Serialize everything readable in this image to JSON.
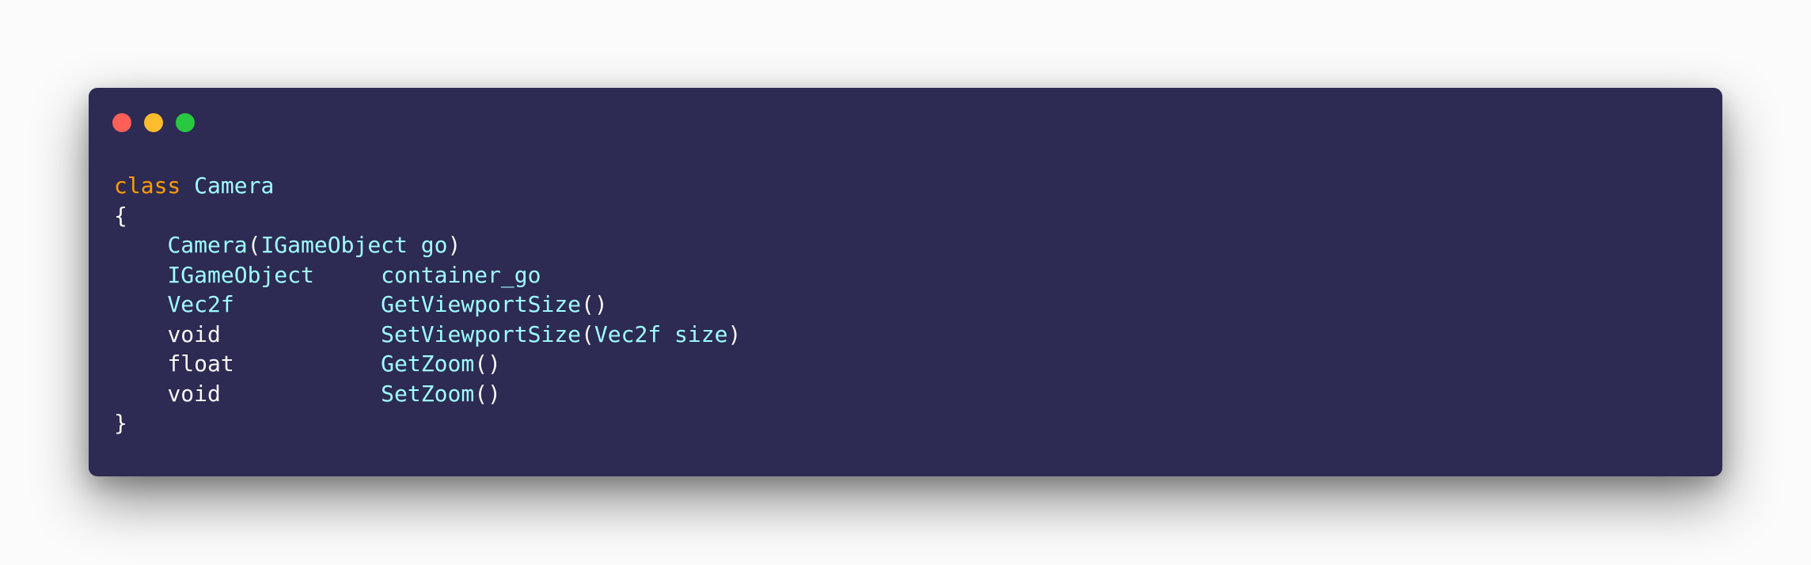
{
  "window": {
    "traffic_lights": [
      {
        "name": "close",
        "color": "#ff5f57"
      },
      {
        "name": "minimize",
        "color": "#febc2e"
      },
      {
        "name": "maximize",
        "color": "#28c840"
      }
    ]
  },
  "code": {
    "lines": [
      [
        {
          "text": "class",
          "kind": "keyword"
        },
        {
          "text": " ",
          "kind": "plain"
        },
        {
          "text": "Camera",
          "kind": "type"
        }
      ],
      [
        {
          "text": "{",
          "kind": "plain"
        }
      ],
      [
        {
          "text": "    ",
          "kind": "plain"
        },
        {
          "text": "Camera",
          "kind": "type"
        },
        {
          "text": "(",
          "kind": "plain"
        },
        {
          "text": "IGameObject go",
          "kind": "type"
        },
        {
          "text": ")",
          "kind": "plain"
        }
      ],
      [
        {
          "text": "    ",
          "kind": "plain"
        },
        {
          "text": "IGameObject",
          "kind": "type"
        },
        {
          "text": "     ",
          "kind": "plain"
        },
        {
          "text": "container_go",
          "kind": "type"
        }
      ],
      [
        {
          "text": "    ",
          "kind": "plain"
        },
        {
          "text": "Vec2f",
          "kind": "type"
        },
        {
          "text": "           ",
          "kind": "plain"
        },
        {
          "text": "GetViewportSize",
          "kind": "type"
        },
        {
          "text": "()",
          "kind": "plain"
        }
      ],
      [
        {
          "text": "    ",
          "kind": "plain"
        },
        {
          "text": "void",
          "kind": "plain"
        },
        {
          "text": "            ",
          "kind": "plain"
        },
        {
          "text": "SetViewportSize",
          "kind": "type"
        },
        {
          "text": "(",
          "kind": "plain"
        },
        {
          "text": "Vec2f size",
          "kind": "type"
        },
        {
          "text": ")",
          "kind": "plain"
        }
      ],
      [
        {
          "text": "    ",
          "kind": "plain"
        },
        {
          "text": "float",
          "kind": "plain"
        },
        {
          "text": "           ",
          "kind": "plain"
        },
        {
          "text": "GetZoom",
          "kind": "type"
        },
        {
          "text": "()",
          "kind": "plain"
        }
      ],
      [
        {
          "text": "    ",
          "kind": "plain"
        },
        {
          "text": "void",
          "kind": "plain"
        },
        {
          "text": "            ",
          "kind": "plain"
        },
        {
          "text": "SetZoom",
          "kind": "type"
        },
        {
          "text": "()",
          "kind": "plain"
        }
      ],
      [
        {
          "text": "}",
          "kind": "plain"
        }
      ]
    ]
  },
  "colors": {
    "background": "#fbfbfb",
    "window": "#2d2a53",
    "keyword": "#ff9d00",
    "type": "#9effff",
    "plain": "#f8f8f2"
  }
}
